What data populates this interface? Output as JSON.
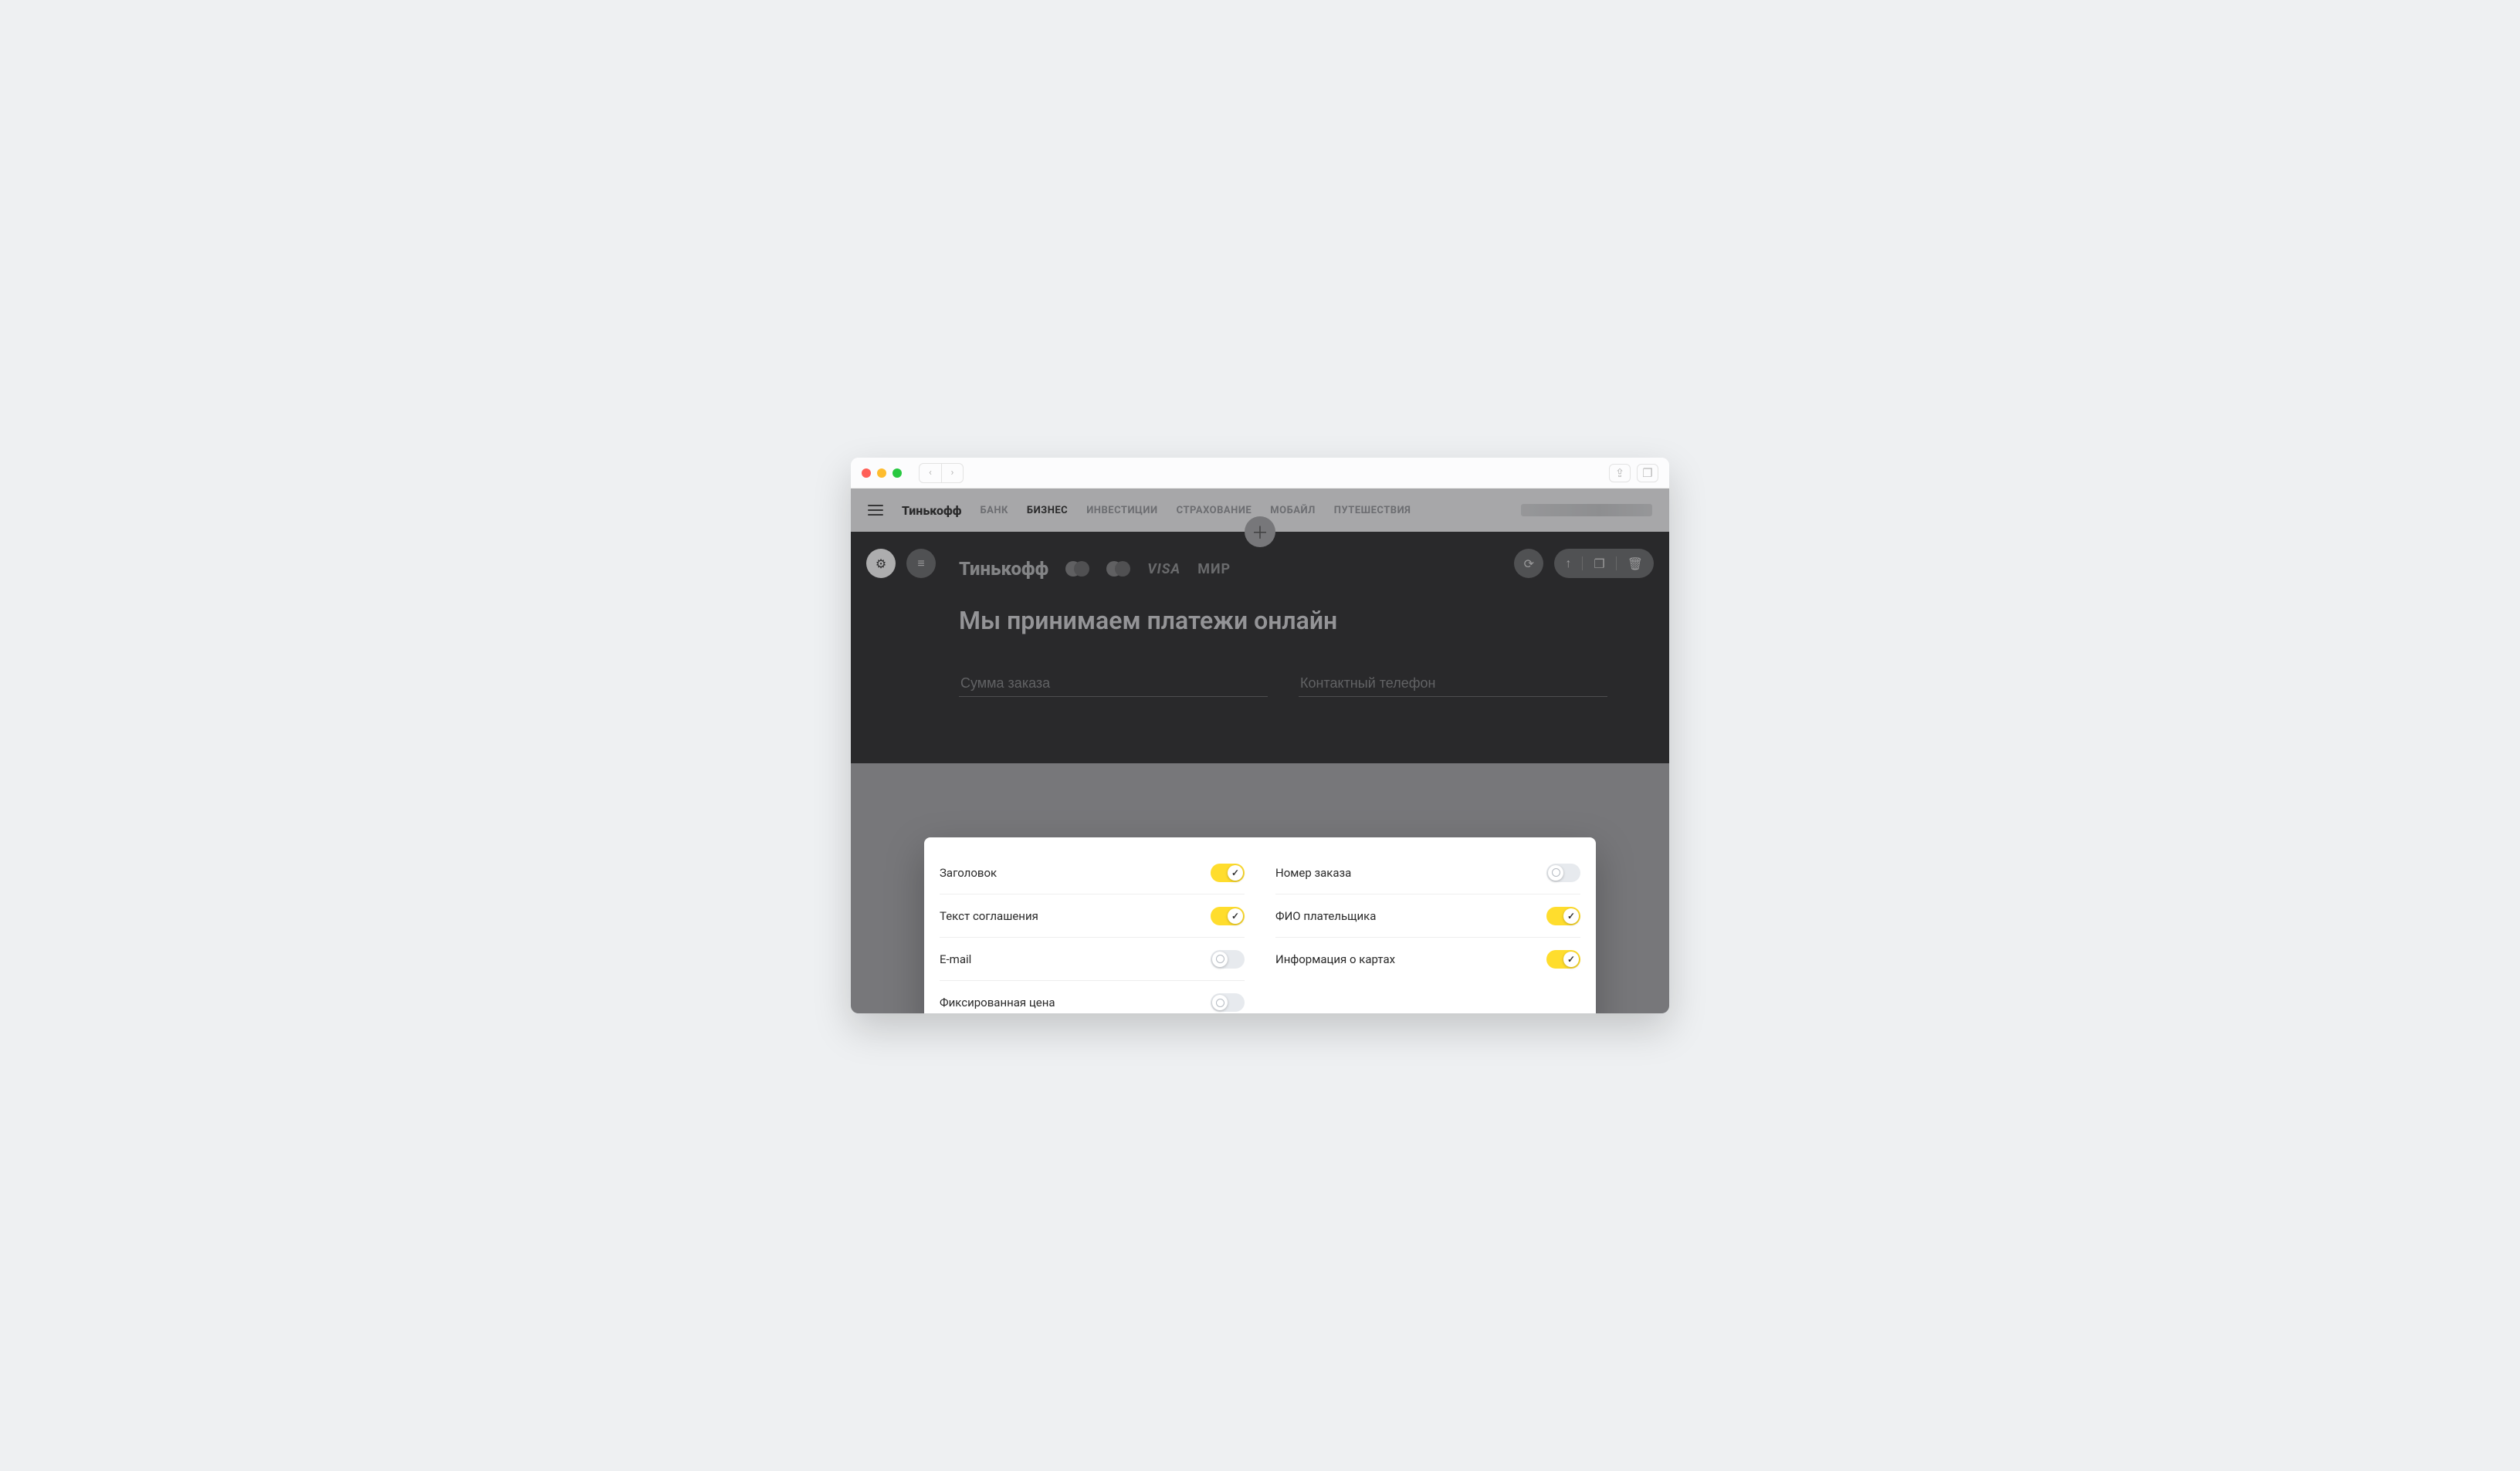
{
  "brand": "Тинькофф",
  "nav": {
    "items": [
      "БАНК",
      "БИЗНЕС",
      "ИНВЕСТИЦИИ",
      "СТРАХОВАНИЕ",
      "МОБАЙЛ",
      "ПУТЕШЕСТВИЯ"
    ],
    "active_index": 1
  },
  "hero": {
    "logo": "Тинькофф",
    "payment_logos": [
      "MasterCard",
      "Maestro",
      "VISA",
      "МИР"
    ],
    "title": "Мы принимаем платежи онлайн",
    "field_amount_placeholder": "Сумма заказа",
    "field_phone_placeholder": "Контактный телефон"
  },
  "options": {
    "left": [
      {
        "label": "Заголовок",
        "on": true
      },
      {
        "label": "Текст соглашения",
        "on": true
      },
      {
        "label": "E-mail",
        "on": false
      },
      {
        "label": "Фиксированная цена",
        "on": false
      }
    ],
    "right": [
      {
        "label": "Номер заказа",
        "on": false
      },
      {
        "label": "ФИО плательщика",
        "on": true
      },
      {
        "label": "Информация о картах",
        "on": true
      }
    ]
  },
  "colors": {
    "accent": "#ffdd2d"
  }
}
